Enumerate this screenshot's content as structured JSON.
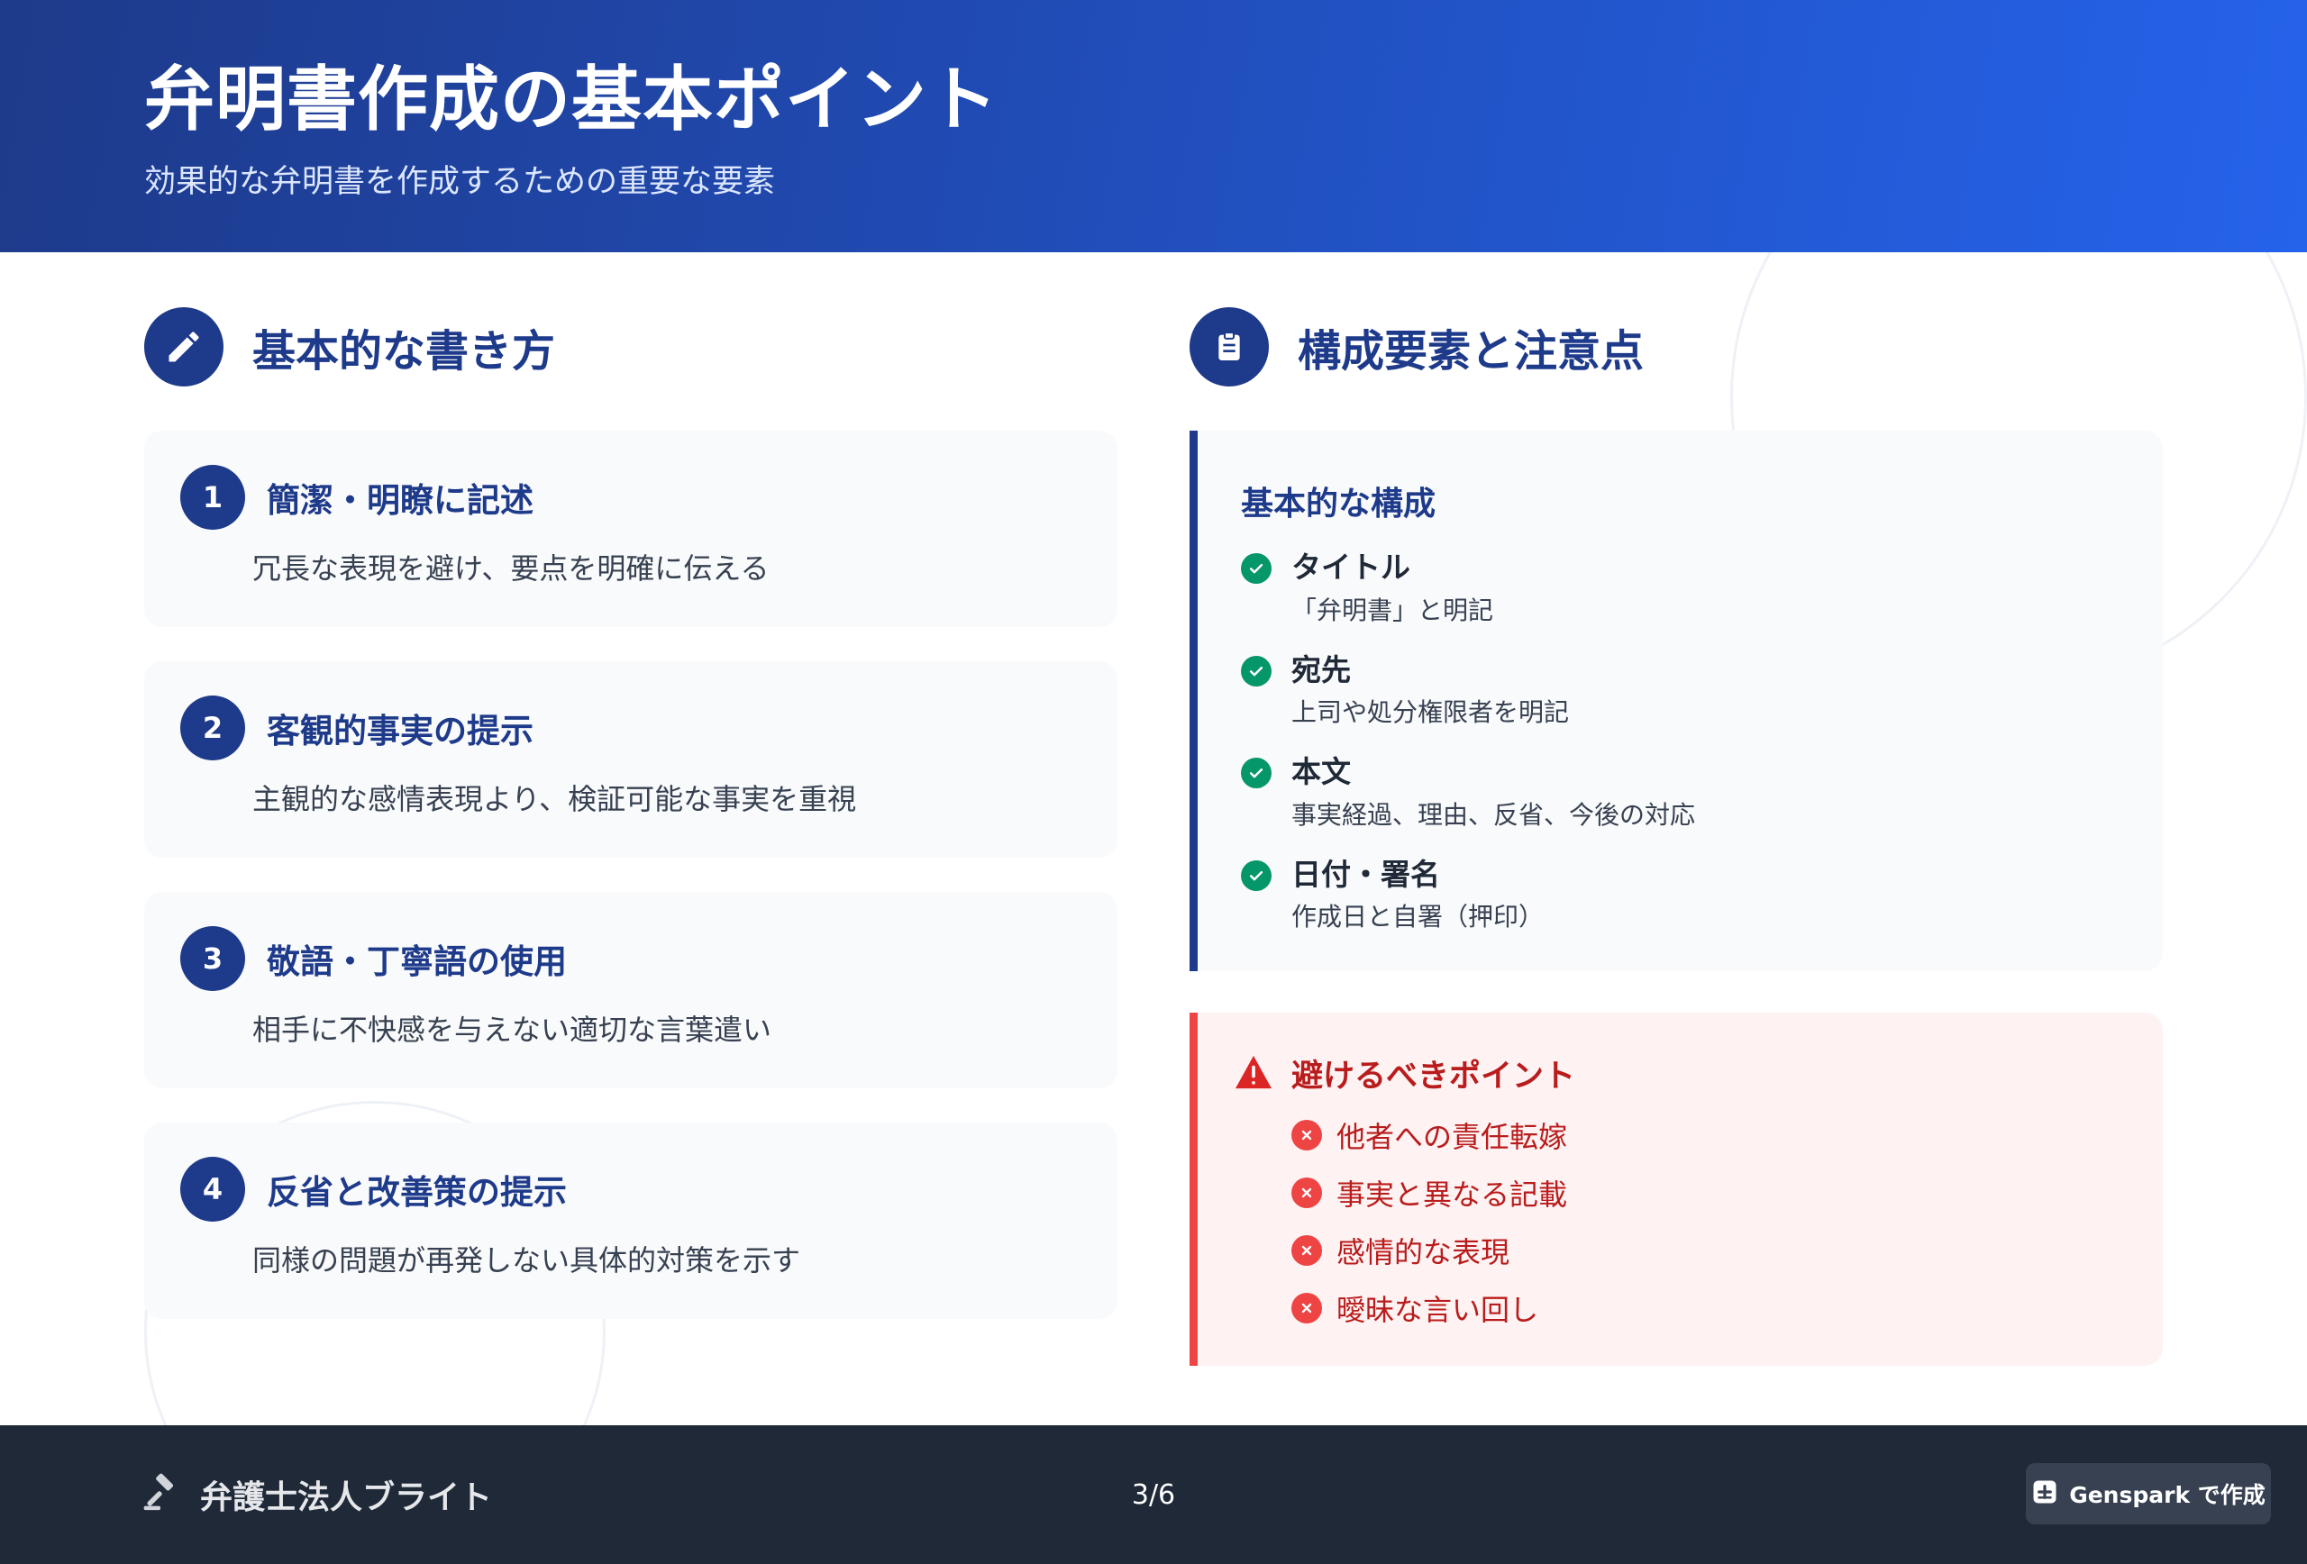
{
  "header": {
    "title": "弁明書作成の基本ポイント",
    "subtitle": "効果的な弁明書を作成するための重要な要素"
  },
  "left_section": {
    "title": "基本的な書き方",
    "icon": "pencil-icon",
    "items": [
      {
        "number": "1",
        "title": "簡潔・明瞭に記述",
        "desc": "冗長な表現を避け、要点を明確に伝える"
      },
      {
        "number": "2",
        "title": "客観的事実の提示",
        "desc": "主観的な感情表現より、検証可能な事実を重視"
      },
      {
        "number": "3",
        "title": "敬語・丁寧語の使用",
        "desc": "相手に不快感を与えない適切な言葉遣い"
      },
      {
        "number": "4",
        "title": "反省と改善策の提示",
        "desc": "同様の問題が再発しない具体的対策を示す"
      }
    ]
  },
  "right_section": {
    "title": "構成要素と注意点",
    "icon": "clipboard-icon",
    "structure": {
      "title": "基本的な構成",
      "items": [
        {
          "label": "タイトル",
          "desc": "「弁明書」と明記"
        },
        {
          "label": "宛先",
          "desc": "上司や処分権限者を明記"
        },
        {
          "label": "本文",
          "desc": "事実経過、理由、反省、今後の対応"
        },
        {
          "label": "日付・署名",
          "desc": "作成日と自署（押印）"
        }
      ]
    },
    "avoid": {
      "title": "避けるべきポイント",
      "items": [
        "他者への責任転嫁",
        "事実と異なる記載",
        "感情的な表現",
        "曖昧な言い回し"
      ]
    }
  },
  "footer": {
    "brand": "弁護士法人ブライト",
    "page": "3/6",
    "genspark_label": "Genspark で作成"
  },
  "colors": {
    "primary": "#1e3a8a",
    "header_gradient_end": "#2563eb",
    "success": "#059669",
    "danger": "#ef4444",
    "danger_text": "#b91c1c",
    "footer_bg": "#1f2937"
  }
}
